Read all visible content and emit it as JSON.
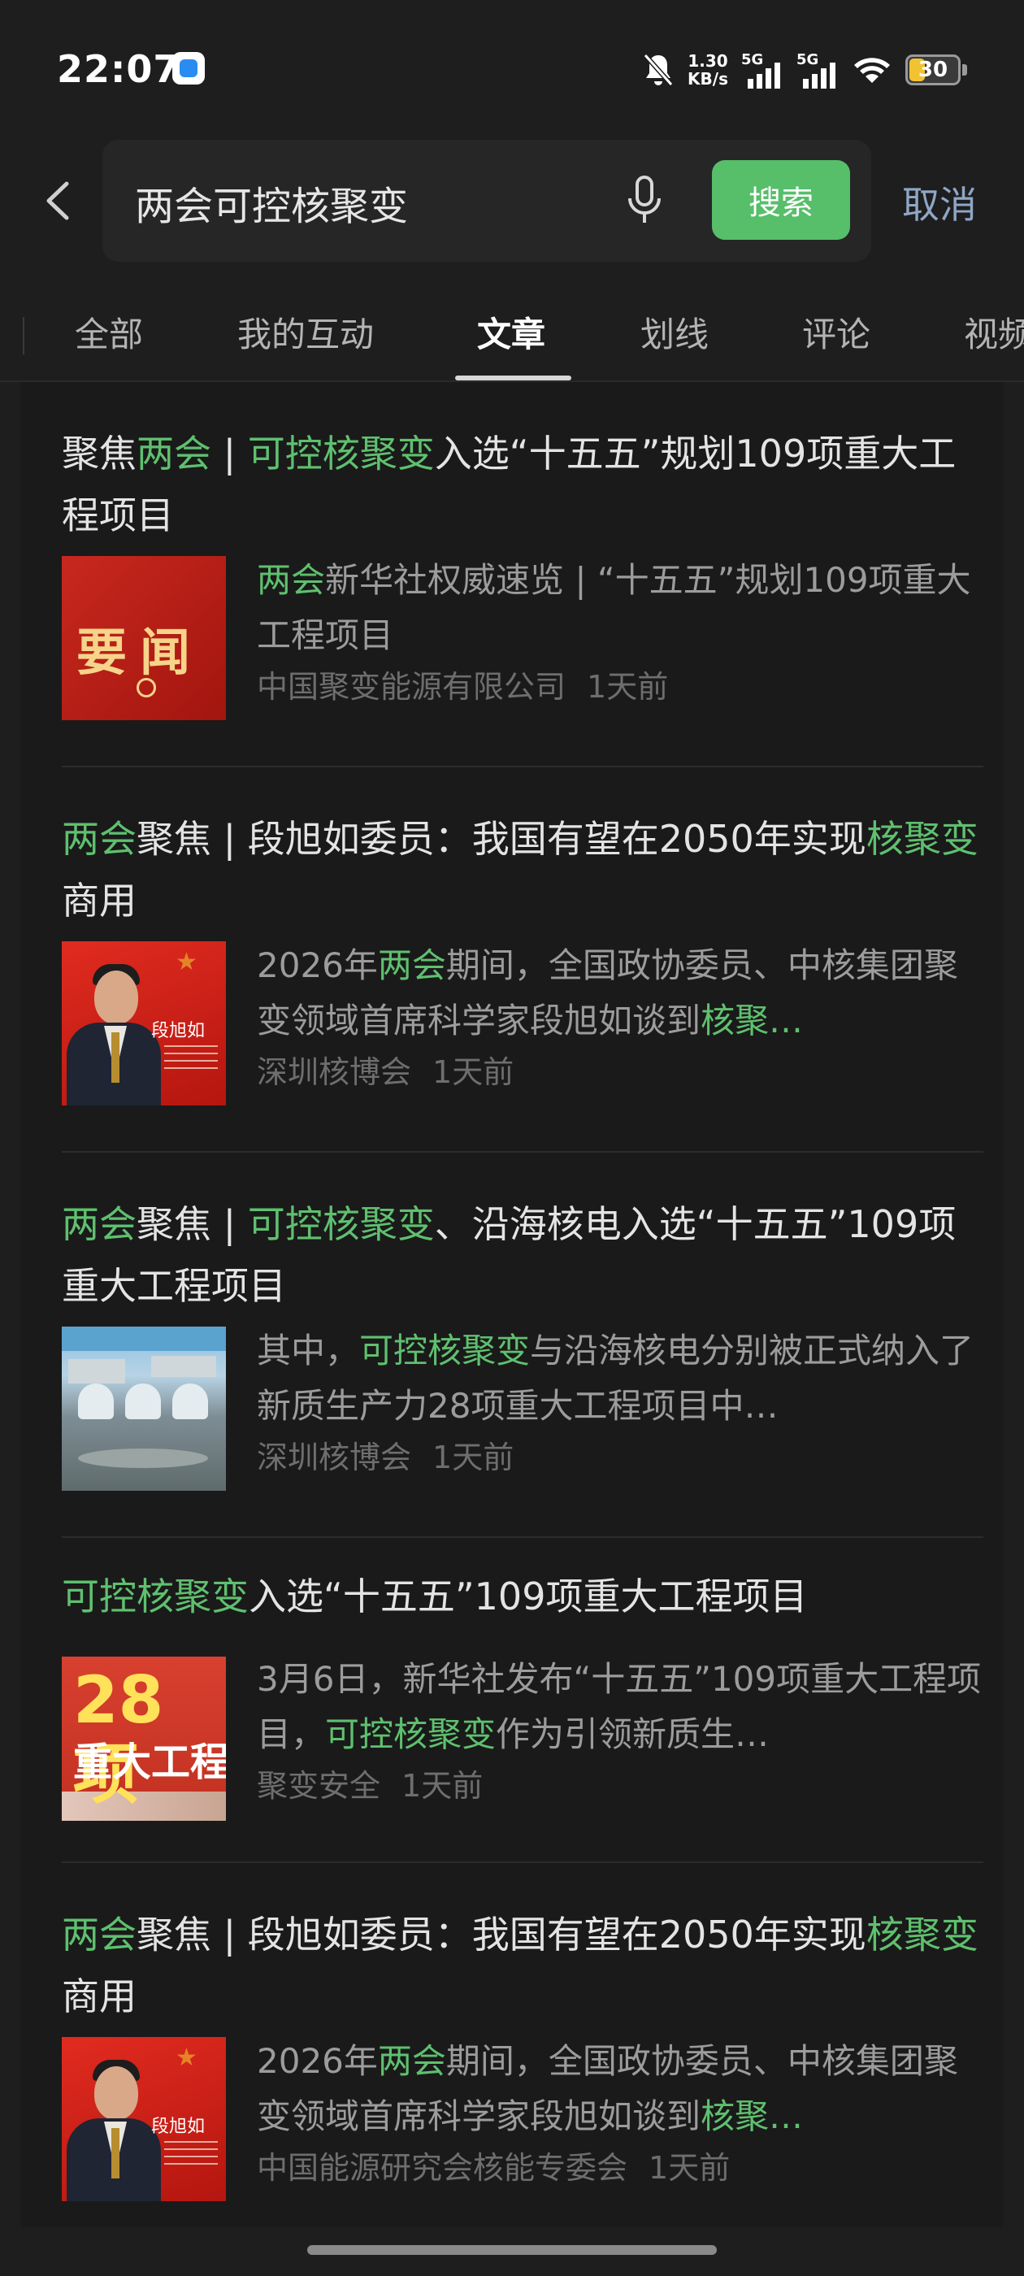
{
  "status_bar": {
    "time": "22:07",
    "net_speed_value": "1.30",
    "net_speed_unit": "KB/s",
    "signal_1": "5G",
    "signal_2": "5G",
    "battery": "30",
    "icons": [
      "mute-icon",
      "wifi-icon",
      "battery-icon"
    ]
  },
  "search": {
    "query": "两会可控核聚变",
    "search_button": "搜索",
    "cancel": "取消"
  },
  "tabs": [
    {
      "label": "全部",
      "active": false
    },
    {
      "label": "我的互动",
      "active": false
    },
    {
      "label": "文章",
      "active": true
    },
    {
      "label": "划线",
      "active": false
    },
    {
      "label": "评论",
      "active": false
    },
    {
      "label": "视频",
      "active": false
    }
  ],
  "articles": [
    {
      "title": [
        {
          "t": "聚焦",
          "h": false
        },
        {
          "t": "两会",
          "h": true
        },
        {
          "t": " | ",
          "h": false
        },
        {
          "t": "可控核聚变",
          "h": true
        },
        {
          "t": "入选“十五五”规划109项重大工程项目",
          "h": false
        }
      ],
      "desc": [
        {
          "t": "两会",
          "h": true
        },
        {
          "t": "新华社权威速览 | “十五五”规划109项重大工程项目",
          "h": false
        }
      ],
      "source": "中国聚变能源有限公司",
      "time": "1天前",
      "thumb": {
        "type": "news",
        "text": "要闻"
      }
    },
    {
      "title": [
        {
          "t": "两会",
          "h": true
        },
        {
          "t": "聚焦 | 段旭如委员：我国有望在2050年实现",
          "h": false
        },
        {
          "t": "核聚变",
          "h": true
        },
        {
          "t": "商用",
          "h": false
        }
      ],
      "desc": [
        {
          "t": "2026年",
          "h": false
        },
        {
          "t": "两会",
          "h": true
        },
        {
          "t": "期间，全国政协委员、中核集团聚变领域首席科学家段旭如谈到",
          "h": false
        },
        {
          "t": "核聚…",
          "h": true
        }
      ],
      "source": "深圳核博会",
      "time": "1天前",
      "thumb": {
        "type": "person",
        "text": "段旭如"
      }
    },
    {
      "title": [
        {
          "t": "两会",
          "h": true
        },
        {
          "t": "聚焦 | ",
          "h": false
        },
        {
          "t": "可控核聚变",
          "h": true
        },
        {
          "t": "、沿海核电入选“十五五”109项重大工程项目",
          "h": false
        }
      ],
      "desc": [
        {
          "t": "其中，",
          "h": false
        },
        {
          "t": "可控核聚变",
          "h": true
        },
        {
          "t": "与沿海核电分别被正式纳入了新质生产力28项重大工程项目中…",
          "h": false
        }
      ],
      "source": "深圳核博会",
      "time": "1天前",
      "thumb": {
        "type": "plant",
        "text": ""
      }
    },
    {
      "title": [
        {
          "t": "可控核聚变",
          "h": true
        },
        {
          "t": "入选“十五五”109项重大工程项目",
          "h": false
        }
      ],
      "desc": [
        {
          "t": "3月6日，新华社发布“十五五”109项重大工程项目，",
          "h": false
        },
        {
          "t": "可控核聚变",
          "h": true
        },
        {
          "t": "作为引领新质生…",
          "h": false
        }
      ],
      "source": "聚变安全",
      "time": "1天前",
      "thumb": {
        "type": "28",
        "text": "28项",
        "text2": "重大工程"
      }
    },
    {
      "title": [
        {
          "t": "两会",
          "h": true
        },
        {
          "t": "聚焦 | 段旭如委员：我国有望在2050年实现",
          "h": false
        },
        {
          "t": "核聚变",
          "h": true
        },
        {
          "t": "商用",
          "h": false
        }
      ],
      "desc": [
        {
          "t": "2026年",
          "h": false
        },
        {
          "t": "两会",
          "h": true
        },
        {
          "t": "期间，全国政协委员、中核集团聚变领域首席科学家段旭如谈到",
          "h": false
        },
        {
          "t": "核聚…",
          "h": true
        }
      ],
      "source": "中国能源研究会核能专委会",
      "time": "1天前",
      "thumb": {
        "type": "person",
        "text": "段旭如"
      }
    }
  ]
}
